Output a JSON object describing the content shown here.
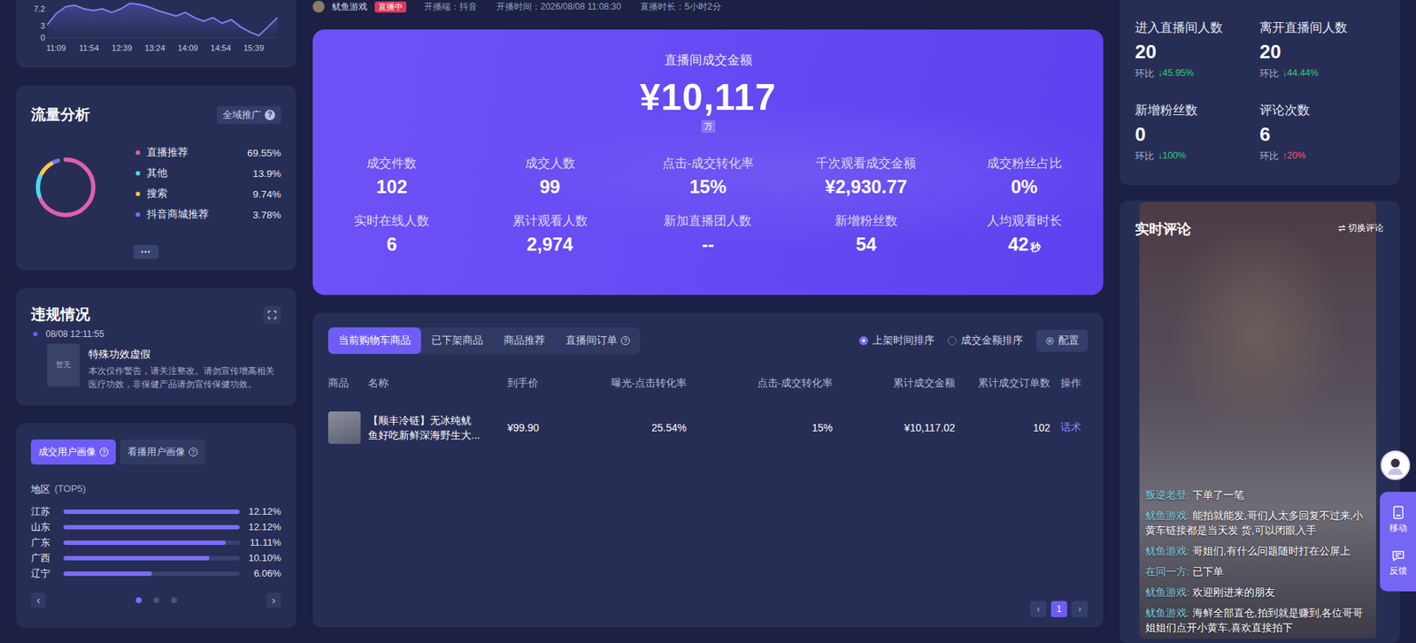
{
  "trend_chart": {
    "y_ticks": [
      "7.2",
      "3",
      "0"
    ],
    "x_labels": [
      "11:09",
      "11:54",
      "12:39",
      "13:24",
      "14:09",
      "14:54",
      "15:39"
    ],
    "values": [
      3.2,
      6.1,
      7.7,
      8.1,
      7.2,
      6.8,
      7.2,
      6.3,
      7.2,
      8.6,
      8.3,
      7.7,
      6.8,
      6.1,
      5.4,
      6.3,
      5.0,
      4.1,
      5.0,
      3.6,
      4.5,
      2.7,
      1.4,
      0.5,
      2.7,
      5.0
    ]
  },
  "traffic": {
    "title": "流量分析",
    "badge": "全域推广",
    "badge_icon": "?",
    "more": "•••",
    "sources": [
      {
        "label": "直播推荐",
        "value": "69.55%",
        "level": 0.6955,
        "color": "#e05fae"
      },
      {
        "label": "其他",
        "value": "13.9%",
        "level": 0.139,
        "color": "#4fd8ea"
      },
      {
        "label": "搜索",
        "value": "9.74%",
        "level": 0.0974,
        "color": "#f3c84b"
      },
      {
        "label": "抖音商城推荐",
        "value": "3.78%",
        "level": 0.0378,
        "color": "#7a73f2"
      }
    ]
  },
  "violations": {
    "title": "违规情况",
    "items": [
      {
        "time": "08/08 12:11:55",
        "thumb": "暂无",
        "title": "特殊功效虚假",
        "description": "本次仅作警告，请关注整改。请勿宣传增高相关医疗功效，非保健产品请勿宣传保健功效。"
      }
    ]
  },
  "portrait": {
    "tabs": [
      {
        "label": "成交用户画像",
        "icon": "?",
        "selected": true
      },
      {
        "label": "看播用户画像",
        "icon": "?",
        "selected": false
      }
    ],
    "section": "地区",
    "section_note": "(TOP5)",
    "regions": [
      {
        "name": "江苏",
        "value": "12.12%",
        "level": 1.0
      },
      {
        "name": "山东",
        "value": "12.12%",
        "level": 1.0
      },
      {
        "name": "广东",
        "value": "11.11%",
        "level": 0.92
      },
      {
        "name": "广西",
        "value": "10.10%",
        "level": 0.83
      },
      {
        "name": "辽宁",
        "value": "6.06%",
        "level": 0.5
      }
    ],
    "prev": "‹",
    "next": "›",
    "pages": [
      {
        "selected": true
      },
      {
        "selected": false
      },
      {
        "selected": false
      }
    ]
  },
  "header": {
    "streamer": "鱿鱼游戏",
    "badge": "直播中",
    "platform": "开播端：抖音",
    "start": "开播时间：2026/08/08 11:08:30",
    "duration": "直播时长：5小时2分"
  },
  "summary": {
    "title": "直播间成交金额",
    "amount": "¥10,117",
    "unit": "万",
    "metrics": [
      {
        "label": "成交件数",
        "value": "102",
        "unit": ""
      },
      {
        "label": "成交人数",
        "value": "99",
        "unit": ""
      },
      {
        "label": "点击-成交转化率",
        "value": "15%",
        "unit": ""
      },
      {
        "label": "千次观看成交金额",
        "value": "¥2,930.77",
        "unit": ""
      },
      {
        "label": "成交粉丝占比",
        "value": "0%",
        "unit": ""
      },
      {
        "label": "实时在线人数",
        "value": "6",
        "unit": ""
      },
      {
        "label": "累计观看人数",
        "value": "2,974",
        "unit": ""
      },
      {
        "label": "新加直播团人数",
        "value": "--",
        "unit": ""
      },
      {
        "label": "新增粉丝数",
        "value": "54",
        "unit": ""
      },
      {
        "label": "人均观看时长",
        "value": "42",
        "unit": "秒"
      }
    ]
  },
  "products": {
    "tabs": [
      {
        "label": "当前购物车商品",
        "icon": "",
        "selected": true
      },
      {
        "label": "已下架商品",
        "icon": "",
        "selected": false
      },
      {
        "label": "商品推荐",
        "icon": "",
        "selected": false
      },
      {
        "label": "直播间订单",
        "icon": "?",
        "selected": false
      }
    ],
    "sort": [
      {
        "label": "上架时间排序",
        "selected": true
      },
      {
        "label": "成交金额排序",
        "selected": false
      }
    ],
    "config": "配置",
    "columns": [
      "商品",
      "名称",
      "到手价",
      "曝光-点击转化率",
      "点击-成交转化率",
      "累计成交金额",
      "累计成交订单数",
      "操作"
    ],
    "rows": [
      {
        "name_lines": [
          "【顺丰冷链】无冰纯鱿",
          "鱼好吃新鲜深海野生大..."
        ],
        "price": "¥99.90",
        "ctr": "25.54%",
        "cvr": "15%",
        "gmv": "¥10,117.02",
        "orders": "102",
        "action": "话术"
      }
    ],
    "prev": "‹",
    "pages": [
      {
        "label": "1",
        "selected": true
      }
    ],
    "next": "›"
  },
  "stats": [
    {
      "label": "进入直播间人数",
      "value": "20",
      "compare": "环比",
      "arrow": "↓",
      "change": "45.95%",
      "color": "#2fd07e"
    },
    {
      "label": "离开直播间人数",
      "value": "20",
      "compare": "环比",
      "arrow": "↓",
      "change": "44.44%",
      "color": "#2fd07e"
    },
    {
      "label": "新增粉丝数",
      "value": "0",
      "compare": "环比",
      "arrow": "↓",
      "change": "100%",
      "color": "#2fd07e"
    },
    {
      "label": "评论次数",
      "value": "6",
      "compare": "环比",
      "arrow": "↑",
      "change": "20%",
      "color": "#ff5a6e"
    }
  ],
  "comments": {
    "title": "实时评论",
    "switch": "切换评论",
    "items": [
      {
        "user": "叛逆老登",
        "text": "下单了一笔"
      },
      {
        "user": "鱿鱼游戏",
        "text": "能拍就能发,哥们人太多回复不过来,小黄车链接都是当天发 货,可以闭眼入手"
      },
      {
        "user": "鱿鱼游戏",
        "text": "哥姐们,有什么问题随时打在公屏上"
      },
      {
        "user": "在同一方",
        "text": "已下单"
      },
      {
        "user": "鱿鱼游戏",
        "text": "欢迎刚进来的朋友"
      },
      {
        "user": "鱿鱼游戏",
        "text": "海鲜全部直仓,拍到就是赚到,各位哥哥姐姐们点开小黄车,喜欢直接拍下"
      }
    ]
  },
  "float_tools": [
    {
      "label": "移动"
    },
    {
      "label": "反馈"
    }
  ]
}
